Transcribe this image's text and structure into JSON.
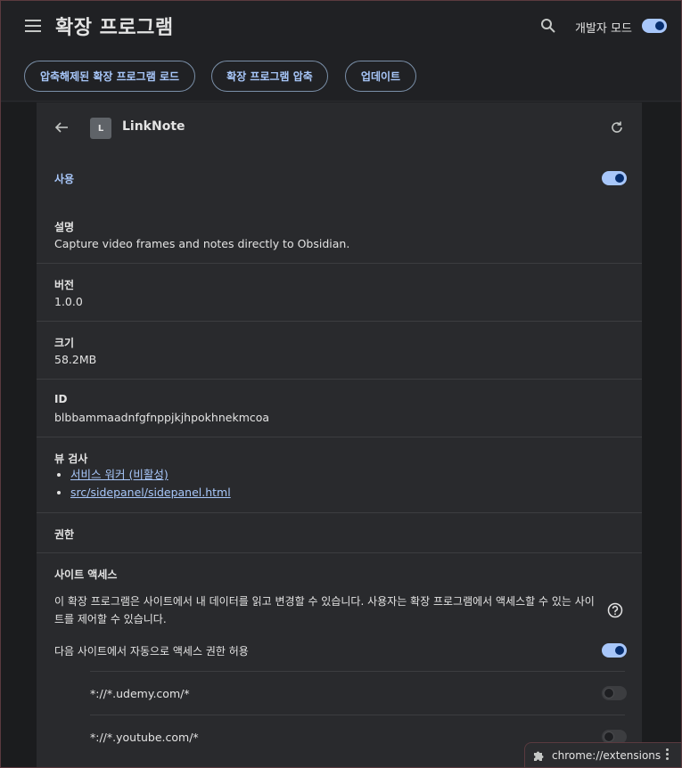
{
  "header": {
    "title": "확장 프로그램",
    "dev_mode_label": "개발자 모드",
    "dev_mode_on": true,
    "menu_icon": "hamburger-menu-icon",
    "search_icon": "search-icon"
  },
  "toolbar": {
    "load_unpacked": "압축해제된 확장 프로그램 로드",
    "pack": "확장 프로그램 압축",
    "update": "업데이트"
  },
  "extension": {
    "logo_letter": "L",
    "name": "LinkNote",
    "enabled_label": "사용",
    "enabled": true,
    "description_label": "설명",
    "description": "Capture video frames and notes directly to Obsidian.",
    "version_label": "버전",
    "version": "1.0.0",
    "size_label": "크기",
    "size": "58.2MB",
    "id_label": "ID",
    "id": "blbbammaadnfgfnppjkjhpokhnekmcoa",
    "inspect_label": "뷰 검사",
    "inspect_links": [
      "서비스 워커 (비활성)",
      "src/sidepanel/sidepanel.html"
    ],
    "permissions_label": "권한",
    "site_access_label": "사이트 액세스",
    "site_access_desc_line1": "이 확장 프로그램은 사이트에서 내 데이터를 읽고 변경할 수 있습니다. 사용자는 확장 프로그램에서 액세스할 수 있는 사이",
    "site_access_desc_line2": "트를 제어할 수 있습니다.",
    "auto_allow_label": "다음 사이트에서 자동으로 액세스 권한 허용",
    "auto_allow_on": true,
    "sites": [
      {
        "pattern": "*://*.udemy.com/*",
        "on": false
      },
      {
        "pattern": "*://*.youtube.com/*",
        "on": false
      }
    ]
  },
  "status_bar": {
    "url": "chrome://extensions"
  },
  "colors": {
    "accent": "#a8c7fa",
    "background": "#202124",
    "card": "#292a2d"
  }
}
